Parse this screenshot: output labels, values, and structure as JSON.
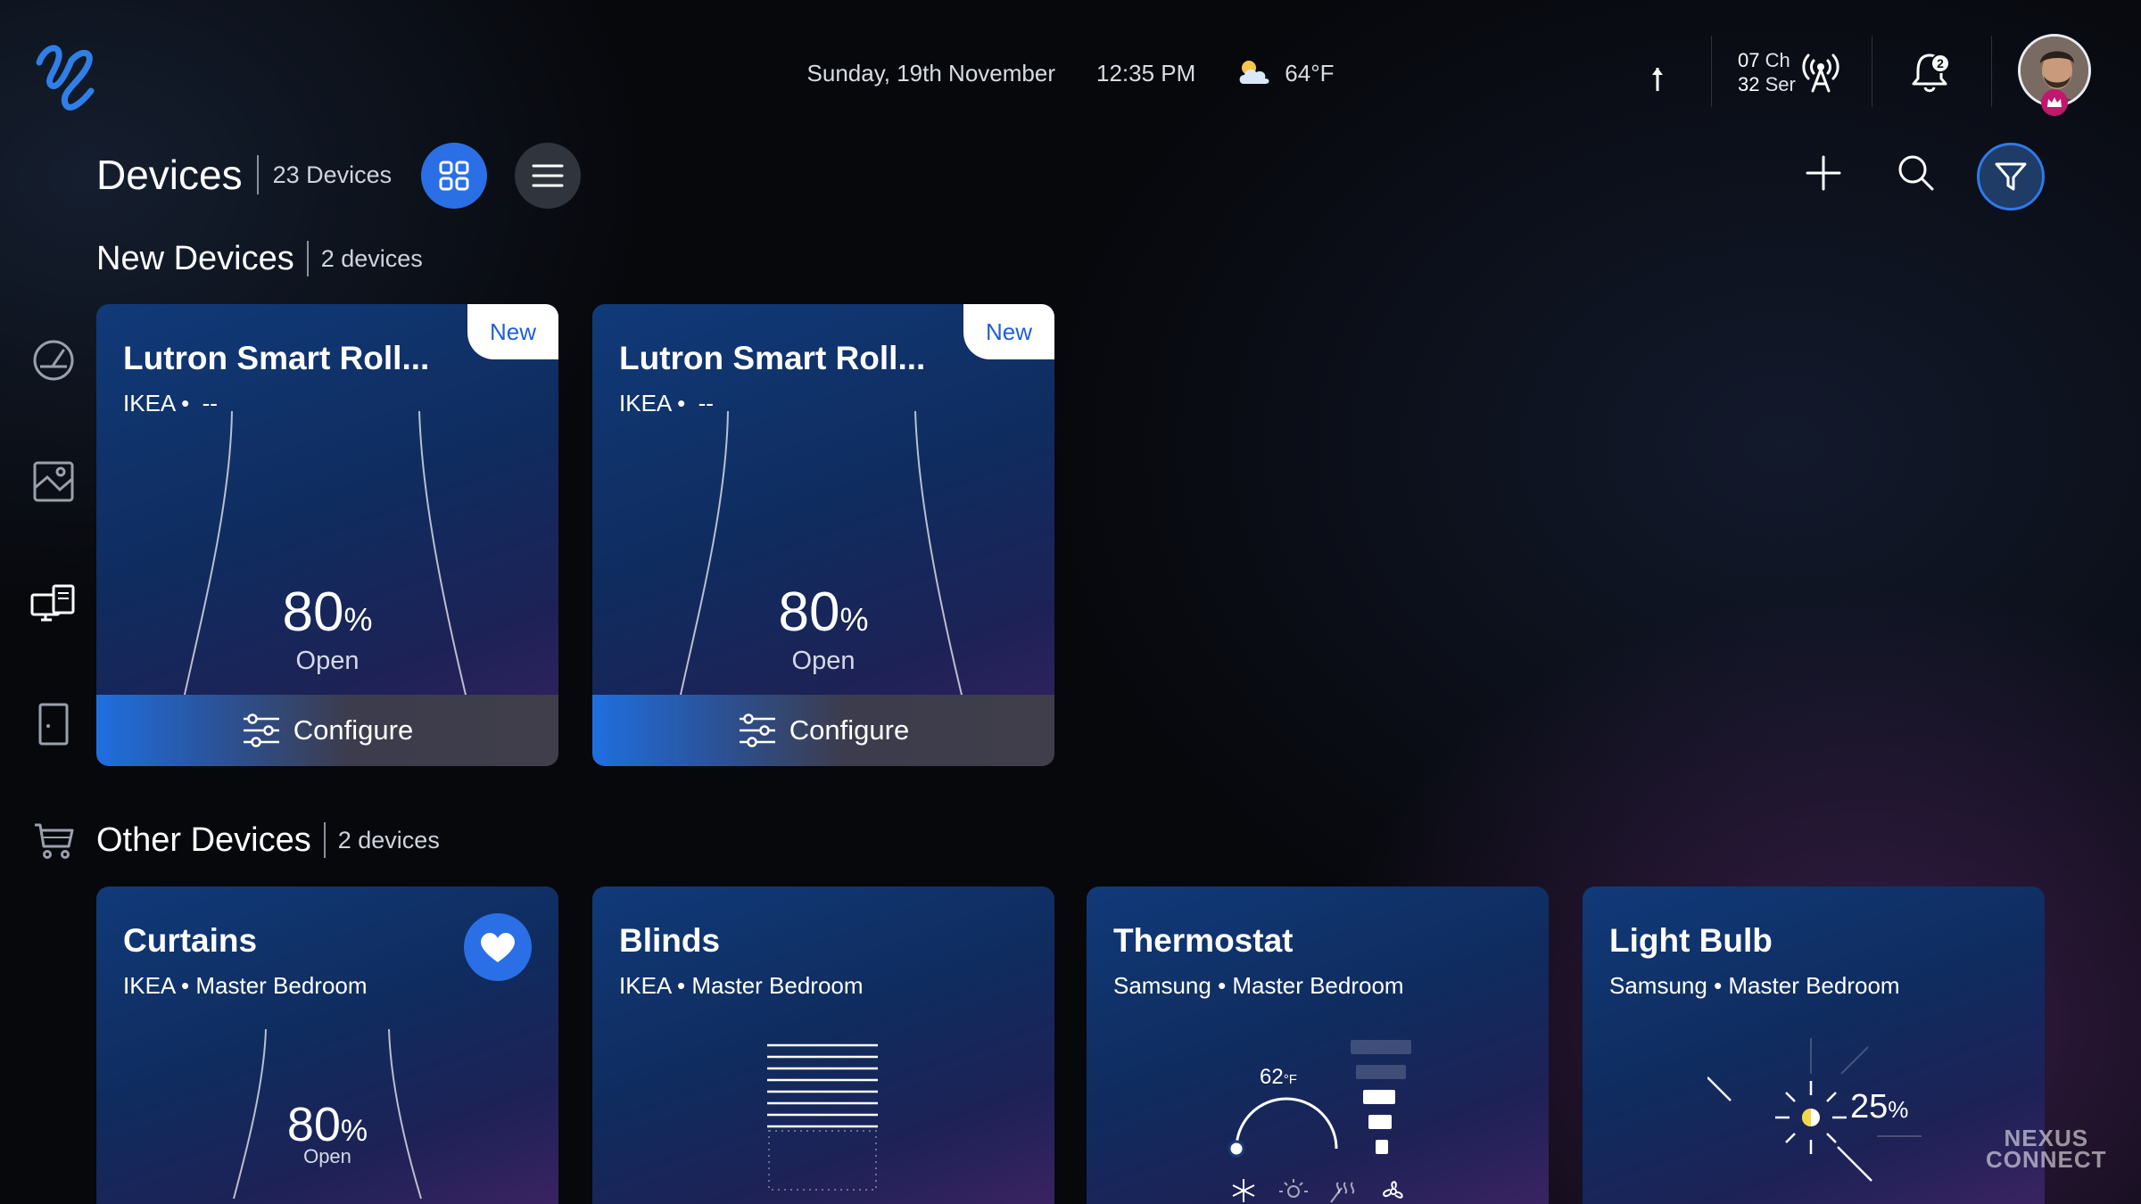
{
  "header": {
    "date": "Sunday, 19th November",
    "time": "12:35 PM",
    "temperature": "64°F",
    "channel_number_1": "07",
    "channel_label_1": "Ch",
    "channel_number_2": "32",
    "channel_label_2": "Ser",
    "notification_count": "2"
  },
  "toolbar": {
    "title": "Devices",
    "device_count": "23 Devices"
  },
  "sections": {
    "new": {
      "title": "New Devices",
      "count": "2 devices"
    },
    "other": {
      "title": "Other Devices",
      "count": "2 devices"
    }
  },
  "new_devices": [
    {
      "name": "Lutron Smart Roll...",
      "brand": "IKEA",
      "dot": "•",
      "room": "--",
      "badge": "New",
      "percent": "80",
      "unit": "%",
      "state": "Open",
      "action": "Configure"
    },
    {
      "name": "Lutron Smart Roll...",
      "brand": "IKEA",
      "dot": "•",
      "room": "--",
      "badge": "New",
      "percent": "80",
      "unit": "%",
      "state": "Open",
      "action": "Configure"
    }
  ],
  "other_devices": [
    {
      "name": "Curtains",
      "subtitle": "IKEA • Master Bedroom",
      "percent": "80",
      "unit": "%",
      "state": "Open",
      "favorite": true
    },
    {
      "name": "Blinds",
      "subtitle": "IKEA • Master Bedroom"
    },
    {
      "name": "Thermostat",
      "subtitle": "Samsung • Master Bedroom",
      "setpoint": "62",
      "setpoint_unit": "°F"
    },
    {
      "name": "Light Bulb",
      "subtitle": "Samsung • Master Bedroom",
      "brightness": "25",
      "unit": "%"
    }
  ],
  "watermark": {
    "line1": "NEXUS",
    "line2": "CONNECT"
  },
  "colors": {
    "accent": "#2a6fe6",
    "badge_text": "#1d5ed8",
    "favorite": "#2a6fe6",
    "crown": "#c2186b"
  },
  "icons": [
    "logo",
    "arrow-up-icon",
    "antenna-icon",
    "bell-icon",
    "crown-icon",
    "grid-view-icon",
    "list-view-icon",
    "plus-icon",
    "search-icon",
    "filter-icon",
    "gauge-icon",
    "image-icon",
    "devices-icon",
    "door-icon",
    "cart-icon",
    "sliders-icon",
    "heart-icon",
    "snowflake-icon",
    "sun-icon",
    "heat-icon",
    "fan-icon"
  ]
}
